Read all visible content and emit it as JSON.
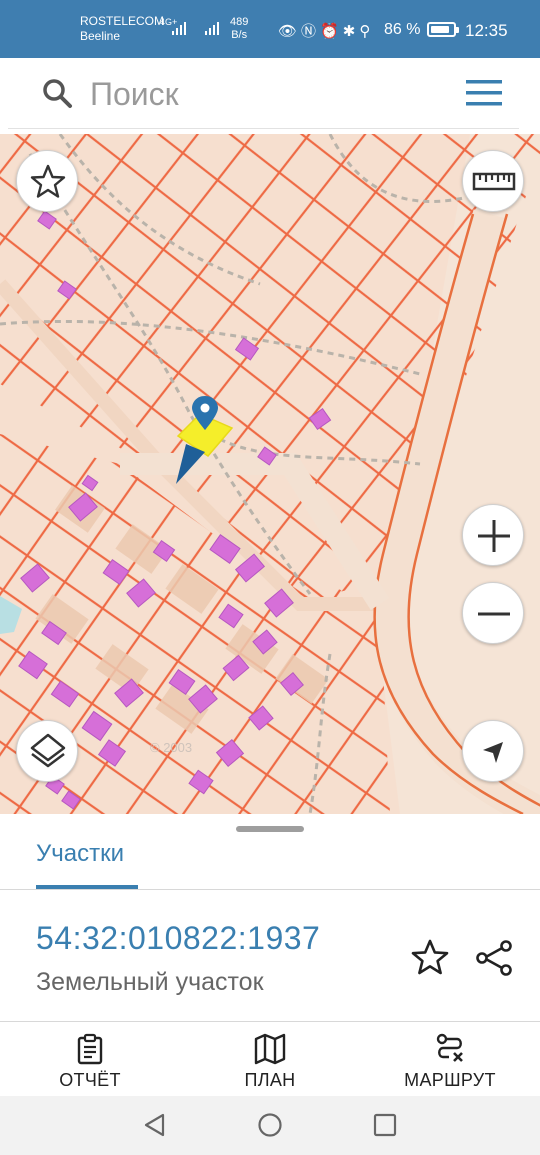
{
  "status_bar": {
    "carrier_primary": "ROSTELECOM",
    "carrier_secondary": "Beeline",
    "network_type": "4G+",
    "net_speed_value": "489",
    "net_speed_unit": "B/s",
    "battery_percent": "86 %",
    "battery_level": 0.86,
    "time": "12:35"
  },
  "search": {
    "placeholder": "Поиск"
  },
  "map": {
    "watermark": "© 2003"
  },
  "sheet": {
    "tab_label": "Участки",
    "parcel_id": "54:32:010822:1937",
    "parcel_type": "Земельный участок"
  },
  "actions": [
    {
      "label": "ОТЧЁТ",
      "icon": "clipboard-icon"
    },
    {
      "label": "ПЛАН",
      "icon": "map-icon"
    },
    {
      "label": "МАРШРУТ",
      "icon": "route-icon"
    }
  ],
  "colors": {
    "status_bar_bg": "#3f7eb0",
    "accent": "#3a7fb0",
    "parcel_line": "#ee6a45",
    "building_fill": "#d66fd8",
    "map_background": "#f6dfcf",
    "selected_parcel": "#f5ee2a"
  }
}
